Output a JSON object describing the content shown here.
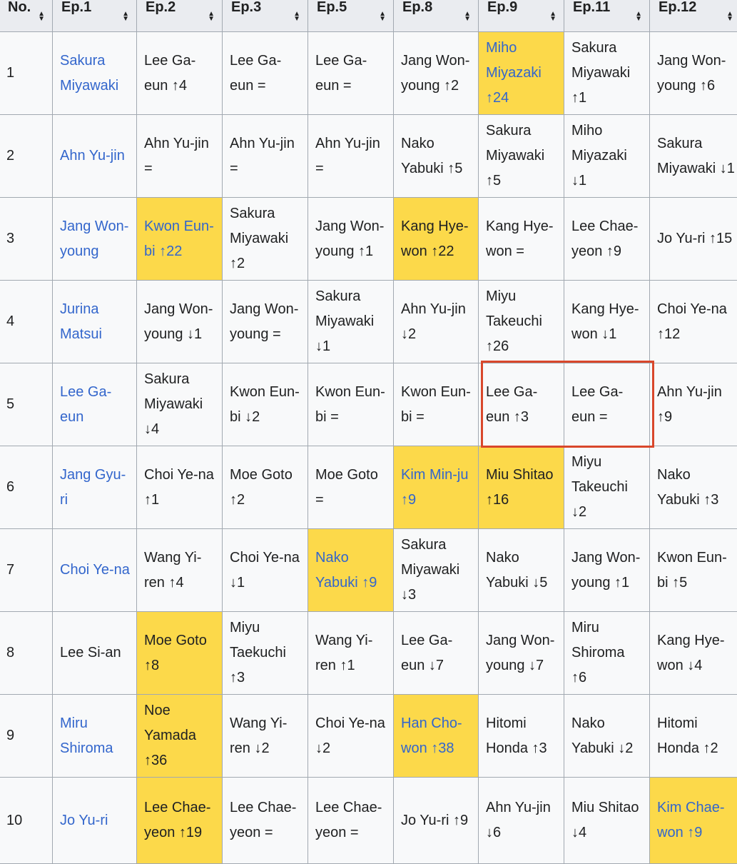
{
  "headers": [
    "No.",
    "Ep.1",
    "Ep.2",
    "Ep.3",
    "Ep.5",
    "Ep.8",
    "Ep.9",
    "Ep.11",
    "Ep.12"
  ],
  "sort_icon": "sort-updown-icon",
  "colors": {
    "highlight": "#fcd94a",
    "link": "#3366cc",
    "selection_border": "#d9472b",
    "header_bg": "#eaecf0",
    "cell_bg": "#f8f9fa"
  },
  "rows": [
    {
      "no": "1",
      "cells": [
        {
          "text": "Sakura Miyawaki",
          "link": true
        },
        {
          "text": "Lee Ga-eun ↑4"
        },
        {
          "text": "Lee Ga-eun ="
        },
        {
          "text": "Lee Ga-eun ="
        },
        {
          "text": "Jang Won-young ↑2"
        },
        {
          "text": "Miho Miyazaki ↑24",
          "highlight": true,
          "link": true
        },
        {
          "text": "Sakura Miyawaki ↑1"
        },
        {
          "text": "Jang Won-young ↑6"
        }
      ]
    },
    {
      "no": "2",
      "cells": [
        {
          "text": "Ahn Yu-jin",
          "link": true
        },
        {
          "text": "Ahn Yu-jin ="
        },
        {
          "text": "Ahn Yu-jin ="
        },
        {
          "text": "Ahn Yu-jin ="
        },
        {
          "text": "Nako Yabuki ↑5"
        },
        {
          "text": "Sakura Miyawaki ↑5"
        },
        {
          "text": "Miho Miyazaki ↓1"
        },
        {
          "text": "Sakura Miyawaki ↓1"
        }
      ]
    },
    {
      "no": "3",
      "cells": [
        {
          "text": "Jang Won-young",
          "link": true
        },
        {
          "text": "Kwon Eun-bi ↑22",
          "highlight": true,
          "link": true
        },
        {
          "text": "Sakura Miyawaki ↑2"
        },
        {
          "text": "Jang Won-young ↑1"
        },
        {
          "text": "Kang Hye-won ↑22",
          "highlight": true
        },
        {
          "text": "Kang Hye-won ="
        },
        {
          "text": "Lee Chae-yeon ↑9"
        },
        {
          "text": "Jo Yu-ri ↑15"
        }
      ]
    },
    {
      "no": "4",
      "cells": [
        {
          "text": "Jurina Matsui",
          "link": true
        },
        {
          "text": "Jang Won-young ↓1"
        },
        {
          "text": "Jang Won-young ="
        },
        {
          "text": "Sakura Miyawaki ↓1"
        },
        {
          "text": "Ahn Yu-jin ↓2"
        },
        {
          "text": "Miyu Takeuchi ↑26"
        },
        {
          "text": "Kang Hye-won ↓1"
        },
        {
          "text": "Choi Ye-na ↑12"
        }
      ]
    },
    {
      "no": "5",
      "cells": [
        {
          "text": "Lee Ga-eun",
          "link": true
        },
        {
          "text": "Sakura Miyawaki ↓4"
        },
        {
          "text": "Kwon Eun-bi ↓2"
        },
        {
          "text": "Kwon Eun-bi ="
        },
        {
          "text": "Kwon Eun-bi ="
        },
        {
          "text": "Lee Ga-eun ↑3"
        },
        {
          "text": "Lee Ga-eun ="
        },
        {
          "text": "Ahn Yu-jin ↑9"
        }
      ]
    },
    {
      "no": "6",
      "cells": [
        {
          "text": "Jang Gyu-ri",
          "link": true
        },
        {
          "text": "Choi Ye-na ↑1"
        },
        {
          "text": "Moe Goto ↑2"
        },
        {
          "text": "Moe Goto ="
        },
        {
          "text": "Kim Min-ju ↑9",
          "highlight": true,
          "link": true
        },
        {
          "text": "Miu Shitao ↑16",
          "highlight": true
        },
        {
          "text": "Miyu Takeuchi ↓2"
        },
        {
          "text": "Nako Yabuki ↑3"
        }
      ]
    },
    {
      "no": "7",
      "cells": [
        {
          "text": "Choi Ye-na",
          "link": true
        },
        {
          "text": "Wang Yi-ren ↑4"
        },
        {
          "text": "Choi Ye-na ↓1"
        },
        {
          "text": "Nako Yabuki ↑9",
          "highlight": true,
          "link": true
        },
        {
          "text": "Sakura Miyawaki ↓3"
        },
        {
          "text": "Nako Yabuki ↓5"
        },
        {
          "text": "Jang Won-young ↑1"
        },
        {
          "text": "Kwon Eun-bi ↑5"
        }
      ]
    },
    {
      "no": "8",
      "cells": [
        {
          "text": "Lee Si-an"
        },
        {
          "text": "Moe Goto ↑8",
          "highlight": true
        },
        {
          "text": "Miyu Taekuchi ↑3"
        },
        {
          "text": "Wang Yi-ren ↑1"
        },
        {
          "text": "Lee Ga-eun ↓7"
        },
        {
          "text": "Jang Won-young ↓7"
        },
        {
          "text": "Miru Shiroma ↑6"
        },
        {
          "text": "Kang Hye-won ↓4"
        }
      ]
    },
    {
      "no": "9",
      "cells": [
        {
          "text": "Miru Shiroma",
          "link": true
        },
        {
          "text": "Noe Yamada ↑36",
          "highlight": true
        },
        {
          "text": "Wang Yi-ren ↓2"
        },
        {
          "text": "Choi Ye-na ↓2"
        },
        {
          "text": "Han Cho-won ↑38",
          "highlight": true,
          "link": true
        },
        {
          "text": "Hitomi Honda ↑3"
        },
        {
          "text": "Nako Yabuki ↓2"
        },
        {
          "text": "Hitomi Honda ↑2"
        }
      ]
    },
    {
      "no": "10",
      "cells": [
        {
          "text": "Jo Yu-ri",
          "link": true
        },
        {
          "text": "Lee Chae-yeon ↑19",
          "highlight": true
        },
        {
          "text": "Lee Chae-yeon ="
        },
        {
          "text": "Lee Chae-yeon ="
        },
        {
          "text": "Jo Yu-ri ↑9"
        },
        {
          "text": "Ahn Yu-jin ↓6"
        },
        {
          "text": "Miu Shitao ↓4"
        },
        {
          "text": "Kim Chae-won ↑9",
          "highlight": true,
          "link": true
        }
      ]
    }
  ]
}
